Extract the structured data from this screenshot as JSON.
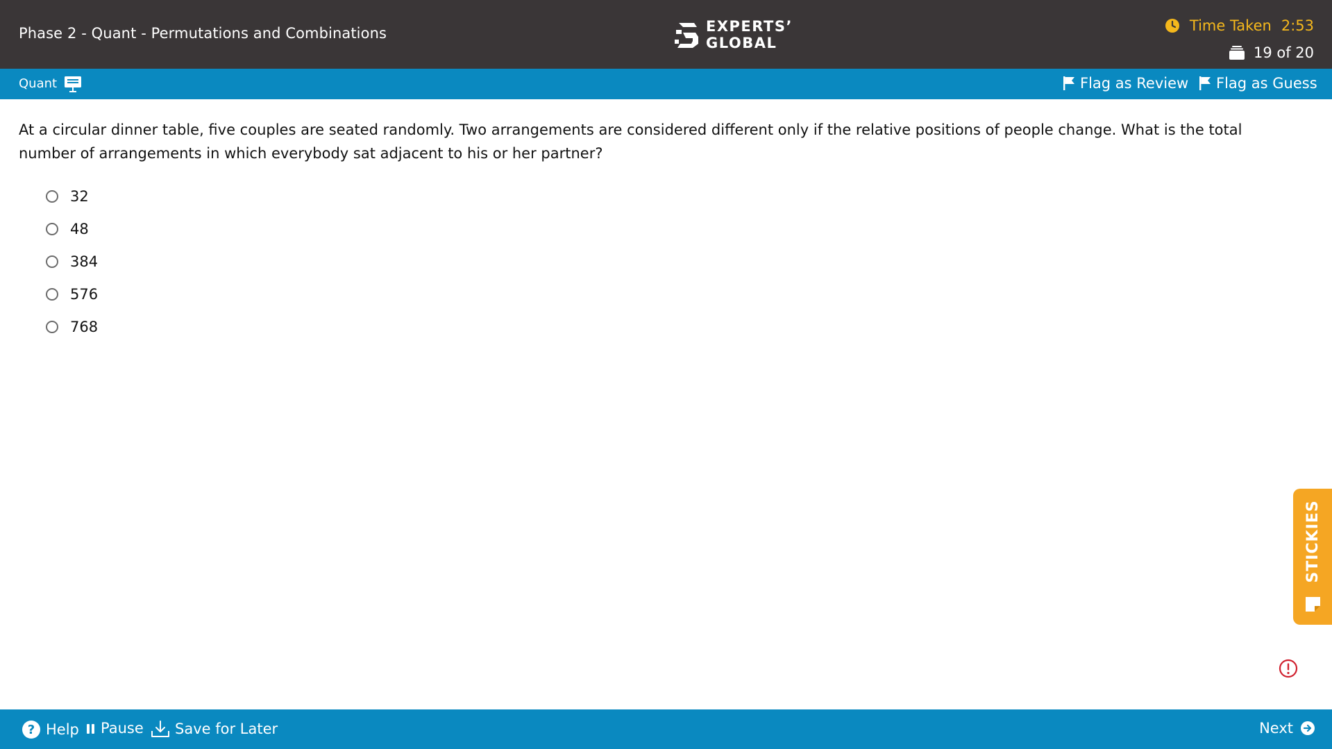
{
  "header": {
    "title": "Phase 2 - Quant - Permutations and Combinations",
    "logo_line1": "EXPERTS’",
    "logo_line2": "GLOBAL",
    "time_label": "Time Taken",
    "time_value": "2:53",
    "question_counter": "19 of 20",
    "accent_color": "#f5b81c",
    "background_color": "#3a3637"
  },
  "section_bar": {
    "section_label": "Quant",
    "flag_review_label": "Flag as Review",
    "flag_guess_label": "Flag as Guess",
    "background_color": "#0a89c0"
  },
  "question": {
    "text": "At a circular dinner table, five couples are seated randomly. Two arrangements are considered different only if the relative positions of people change. What is the total number of arrangements in which everybody sat adjacent to his or her partner?",
    "options": [
      "32",
      "48",
      "384",
      "576",
      "768"
    ],
    "selected_option": null
  },
  "side_tab": {
    "label": "STICKIES",
    "color": "#f5a623"
  },
  "footer": {
    "help_label": "Help",
    "pause_label": "Pause",
    "save_label": "Save for Later",
    "next_label": "Next",
    "background_color": "#0a89c0"
  },
  "icons": {
    "timer": "clock-icon",
    "counter": "question-stack-icon",
    "section": "whiteboard-icon",
    "flag": "flag-icon",
    "help": "help-circle-icon",
    "pause": "pause-icon",
    "save": "download-icon",
    "next": "arrow-right-circle-icon",
    "stickies": "sticky-note-icon",
    "alert": "alert-circle-icon"
  }
}
